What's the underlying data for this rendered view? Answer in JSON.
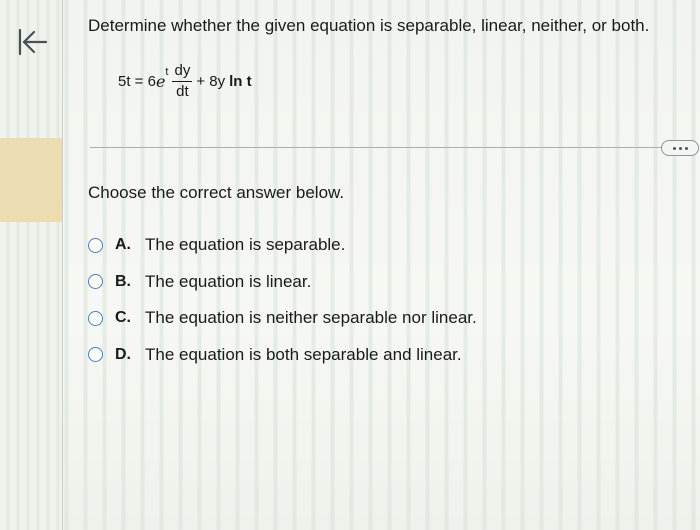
{
  "question": {
    "prompt": "Determine whether the given equation is separable, linear, neither, or both.",
    "equation": {
      "lhs": "5t = 6",
      "exp_base": "e",
      "exp_power": "t",
      "frac_num": "dy",
      "frac_den": "dt",
      "term_plain": "+ 8y",
      "term_bold": "ln t"
    }
  },
  "answer_prompt": "Choose the correct answer below.",
  "options": [
    {
      "letter": "A.",
      "text": "The equation is separable."
    },
    {
      "letter": "B.",
      "text": "The equation is linear."
    },
    {
      "letter": "C.",
      "text": "The equation is neither separable nor linear."
    },
    {
      "letter": "D.",
      "text": "The equation is both separable and linear."
    }
  ],
  "icons": {
    "back": "back-to-start-icon",
    "more": "ellipsis-icon"
  },
  "colors": {
    "radio_border": "#4d7fb8",
    "gutter_highlight": "#ecdcb2"
  }
}
